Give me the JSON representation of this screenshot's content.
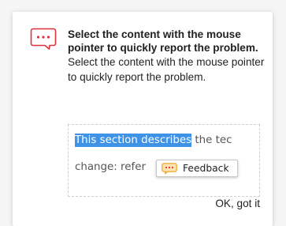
{
  "tip": {
    "icon": "comment-ellipsis-icon",
    "title": "Select the content with the mouse pointer to quickly report the problem.",
    "description": "Select the content with the mouse pointer to quickly report the problem."
  },
  "demo": {
    "highlighted_text": "This section describes",
    "line1_rest": " the tec",
    "line2_text": "change: refer",
    "feedback_button": {
      "icon": "speech-bubble-icon",
      "label": "Feedback"
    }
  },
  "actions": {
    "dismiss_label": "OK, got it"
  },
  "colors": {
    "accent": "#e0313d",
    "highlight": "#3e93e6",
    "feedback_icon": "#f0a21d"
  }
}
